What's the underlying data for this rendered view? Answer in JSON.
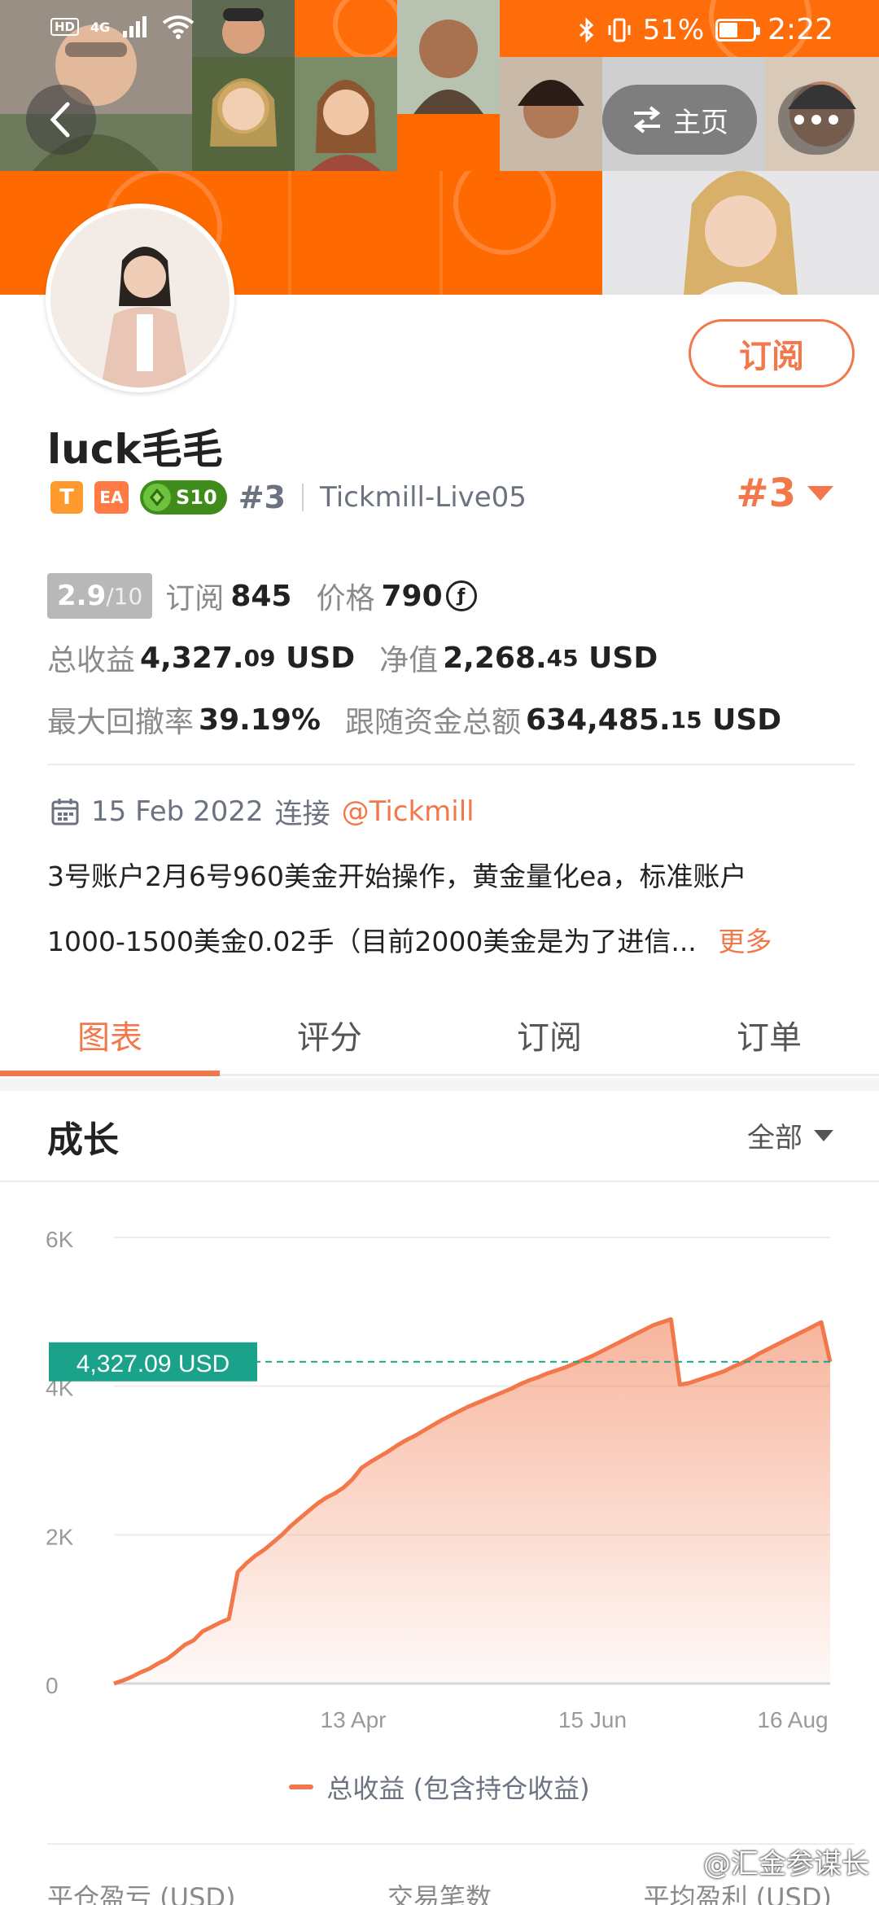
{
  "status_bar": {
    "left_badges": [
      "HD",
      "4G"
    ],
    "battery": "51%",
    "time": "2:22"
  },
  "header": {
    "home_label": "主页",
    "back_icon": "chevron-left-icon",
    "swap_icon": "swap-icon",
    "more_icon": "more-dots-icon"
  },
  "profile": {
    "name": "luck毛毛",
    "subscribe_label": "订阅",
    "badges": {
      "t": "T",
      "ea": "EA",
      "season": "S10"
    },
    "rank_small": "#3",
    "broker": "Tickmill-Live05",
    "rank_big": "#3"
  },
  "stats": {
    "score": "2.9",
    "score_max": "/10",
    "subscribe_label": "订阅",
    "subscribe_count": "845",
    "price_label": "价格",
    "price_value": "790",
    "coin_symbol": "ƒ",
    "total_profit_label": "总收益",
    "total_profit_int": "4,327.",
    "total_profit_dec": "09",
    "total_profit_unit": " USD",
    "equity_label": "净值",
    "equity_int": "2,268.",
    "equity_dec": "45",
    "equity_unit": " USD",
    "drawdown_label": "最大回撤率",
    "drawdown_value": "39.19%",
    "follow_label": "跟随资金总额",
    "follow_int": "634,485.",
    "follow_dec": "15",
    "follow_unit": " USD"
  },
  "joined": {
    "date": "15 Feb 2022",
    "connect_label": "连接",
    "broker_mention": "@Tickmill"
  },
  "description": {
    "line1": "3号账户2月6号960美金开始操作，黄金量化ea，标准账户",
    "line2": "1000-1500美金0.02手（目前2000美金是为了进信...",
    "more": "更多"
  },
  "tabs": [
    {
      "label": "图表",
      "active": true
    },
    {
      "label": "评分",
      "active": false
    },
    {
      "label": "订阅",
      "active": false
    },
    {
      "label": "订单",
      "active": false
    }
  ],
  "growth": {
    "title": "成长",
    "filter": "全部"
  },
  "chart_data": {
    "type": "area",
    "x_tick_labels": [
      "13 Apr",
      "15 Jun",
      "16 Aug"
    ],
    "y_tick_labels": [
      "0",
      "2K",
      "4K",
      "6K"
    ],
    "ylim": [
      0,
      6000
    ],
    "current_value_label": "4,327.09 USD",
    "current_value": 4327.09,
    "legend": "总收益 (包含持仓收益)",
    "series": [
      {
        "name": "总收益 (包含持仓收益)",
        "color": "#f2784b",
        "values": [
          0,
          40,
          90,
          150,
          200,
          270,
          330,
          420,
          520,
          580,
          700,
          760,
          820,
          870,
          1500,
          1620,
          1720,
          1800,
          1900,
          2000,
          2120,
          2220,
          2320,
          2420,
          2500,
          2560,
          2640,
          2750,
          2900,
          2980,
          3050,
          3120,
          3200,
          3270,
          3330,
          3400,
          3470,
          3540,
          3600,
          3660,
          3720,
          3770,
          3820,
          3870,
          3920,
          3970,
          4030,
          4080,
          4120,
          4170,
          4210,
          4250,
          4300,
          4350,
          4400,
          4460,
          4520,
          4580,
          4640,
          4700,
          4760,
          4820,
          4860,
          4900,
          4020,
          4040,
          4080,
          4120,
          4160,
          4200,
          4260,
          4310,
          4370,
          4440,
          4500,
          4560,
          4620,
          4680,
          4740,
          4800,
          4860,
          4327
        ]
      }
    ],
    "grid": true
  },
  "footer": {
    "col1": "平仓盈亏 (USD)",
    "col2": "交易笔数",
    "col3": "平均盈利 (USD)",
    "watermark": "@汇金参谋长"
  }
}
